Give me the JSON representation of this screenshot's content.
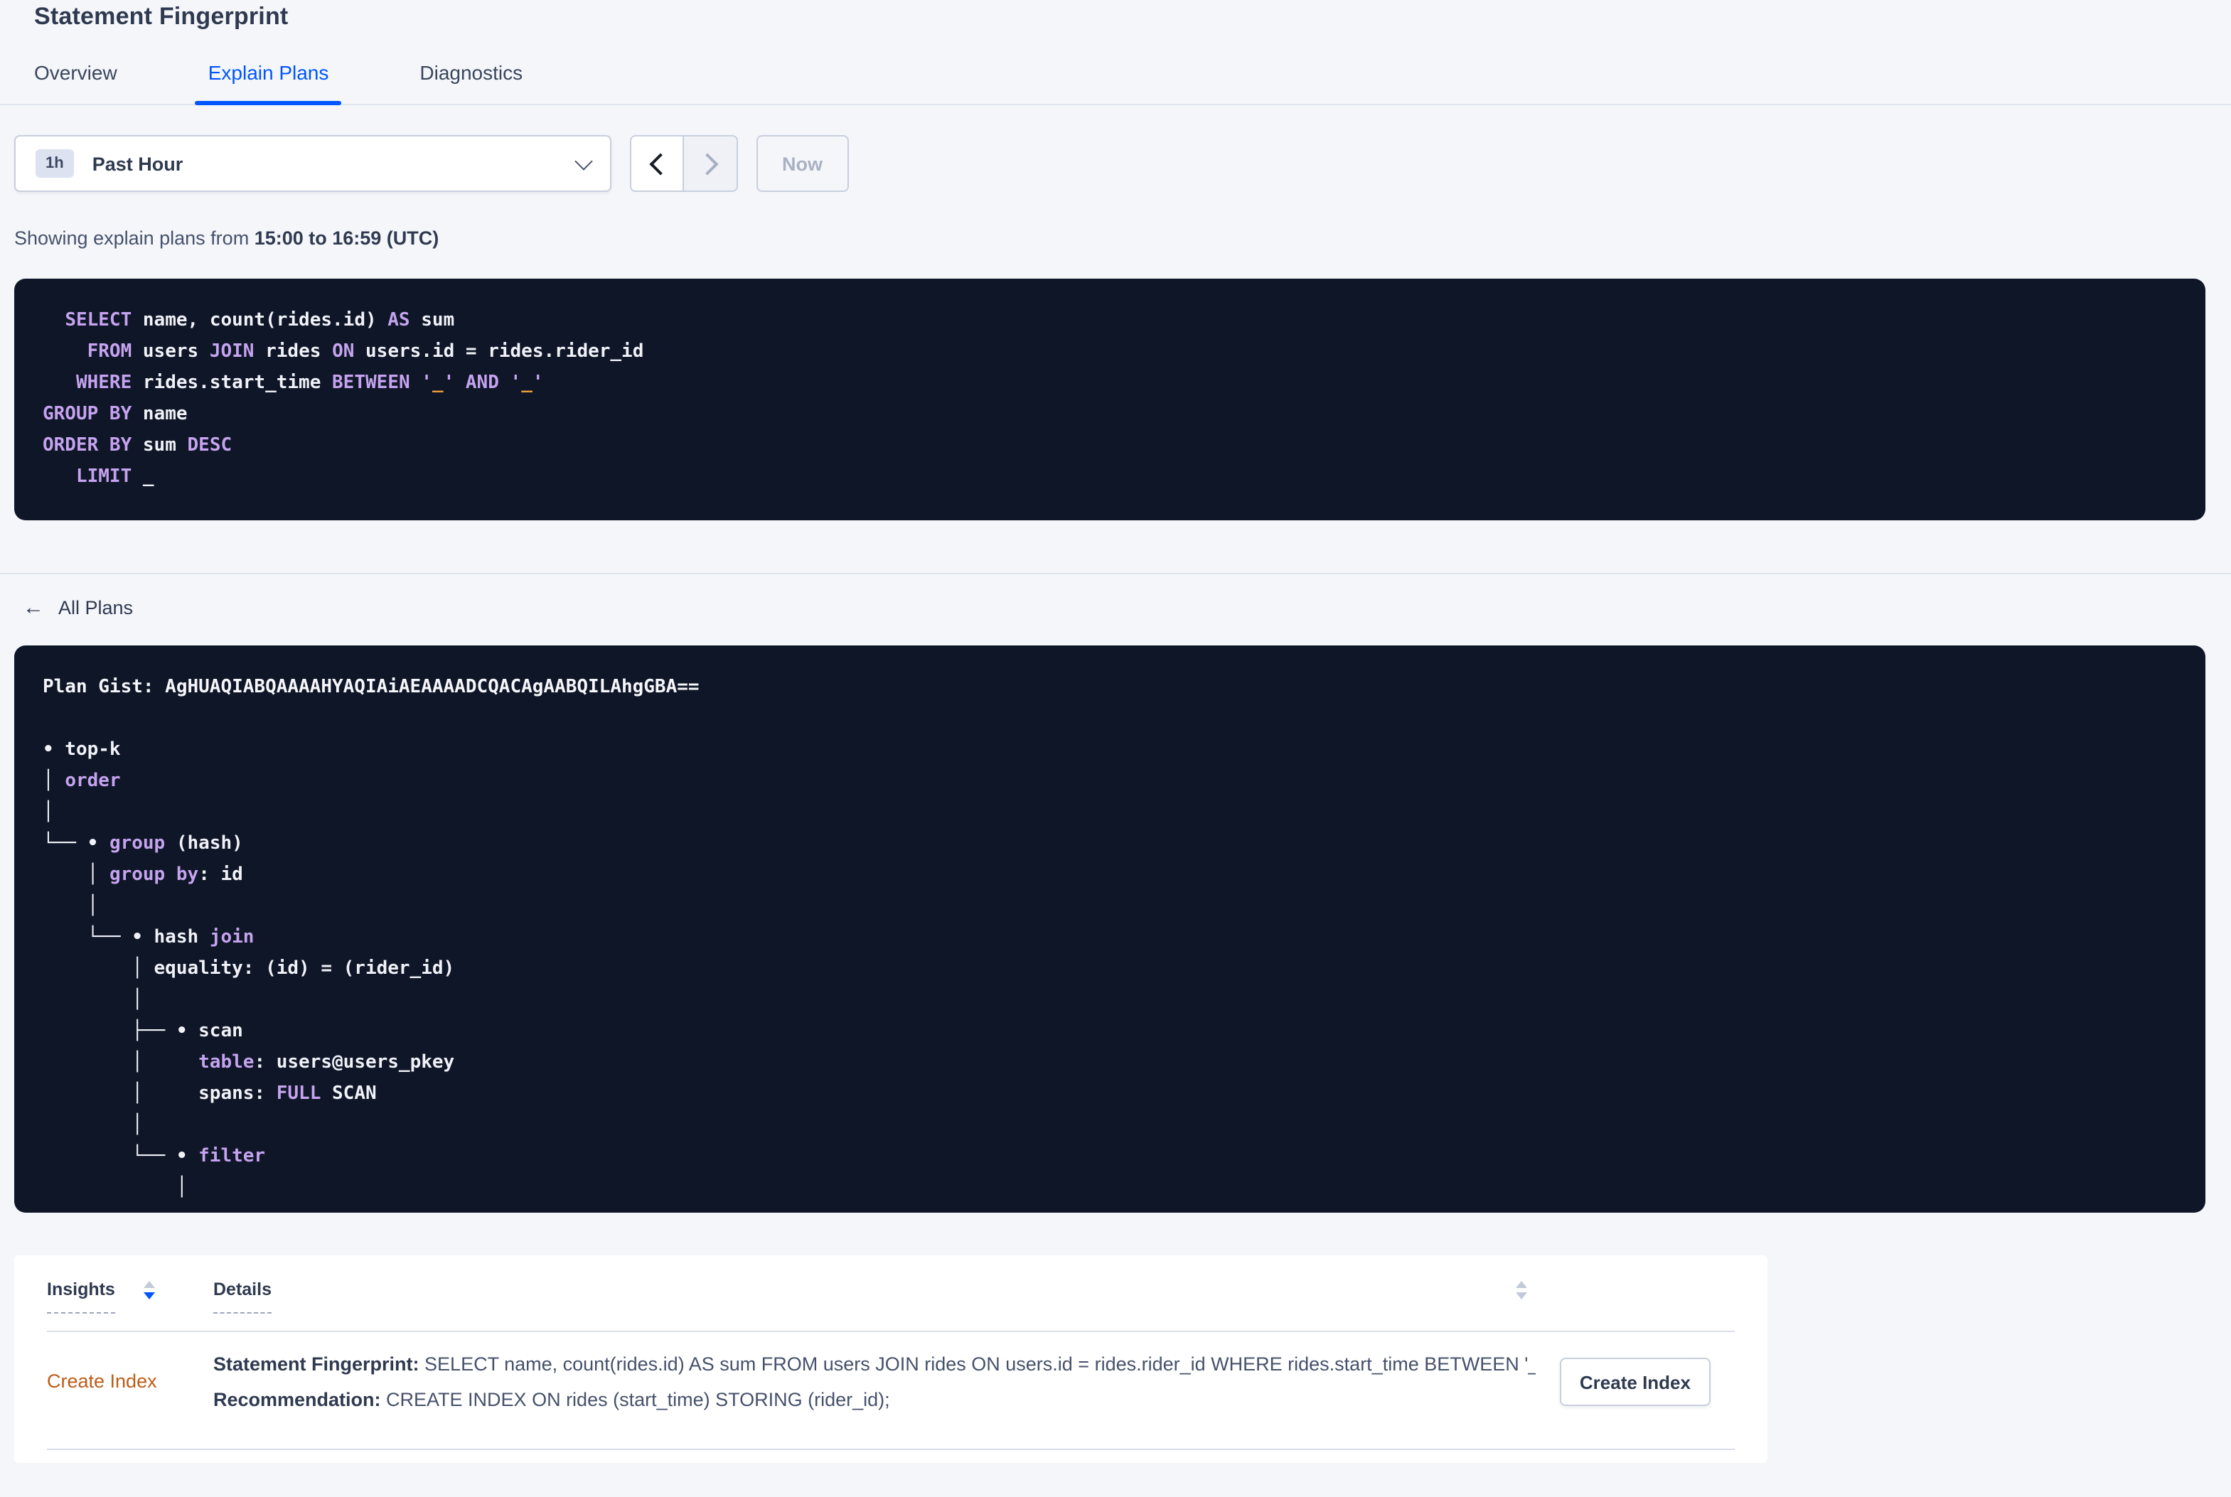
{
  "page": {
    "title": "Statement Fingerprint"
  },
  "tabs": [
    {
      "label": "Overview",
      "active": false
    },
    {
      "label": "Explain Plans",
      "active": true
    },
    {
      "label": "Diagnostics",
      "active": false
    }
  ],
  "time_picker": {
    "interval_badge": "1h",
    "label": "Past Hour",
    "now_label": "Now"
  },
  "summary": {
    "prefix": "Showing explain plans from ",
    "range_bold": "15:00 to 16:59 (UTC)"
  },
  "sql_block": {
    "lines": [
      [
        [
          "  ",
          ""
        ],
        [
          "SELECT",
          "kw"
        ],
        [
          " name, count(rides.id) ",
          ""
        ],
        [
          "AS",
          "kw"
        ],
        [
          " sum",
          ""
        ]
      ],
      [
        [
          "    ",
          ""
        ],
        [
          "FROM",
          "kw"
        ],
        [
          " users ",
          ""
        ],
        [
          "JOIN",
          "kw"
        ],
        [
          " rides ",
          ""
        ],
        [
          "ON",
          "kw"
        ],
        [
          " users.id = rides.rider_id",
          ""
        ]
      ],
      [
        [
          "   ",
          ""
        ],
        [
          "WHERE",
          "kw"
        ],
        [
          " rides.start_time ",
          ""
        ],
        [
          "BETWEEN",
          "kw"
        ],
        [
          " ",
          ""
        ],
        [
          "'",
          "kw"
        ],
        [
          "_",
          "str"
        ],
        [
          "'",
          "kw"
        ],
        [
          " ",
          ""
        ],
        [
          "AND",
          "kw"
        ],
        [
          " ",
          ""
        ],
        [
          "'",
          "kw"
        ],
        [
          "_",
          "str"
        ],
        [
          "'",
          "kw"
        ]
      ],
      [
        [
          "GROUP BY",
          "kw"
        ],
        [
          " name",
          ""
        ]
      ],
      [
        [
          "ORDER BY",
          "kw"
        ],
        [
          " sum ",
          ""
        ],
        [
          "DESC",
          "kw"
        ]
      ],
      [
        [
          "   ",
          ""
        ],
        [
          "LIMIT",
          "kw"
        ],
        [
          " _",
          ""
        ]
      ]
    ]
  },
  "back_link": {
    "label": "All Plans"
  },
  "plan_block": {
    "lines": [
      [
        [
          "Plan Gist: AgHUAQIABQAAAAHYAQIAiAEAAAADCQACAgAABQILAhgGBA==",
          "gist"
        ]
      ],
      [],
      [
        [
          "• top-k",
          ""
        ]
      ],
      [
        [
          "│ ",
          ""
        ],
        [
          "order",
          "kw"
        ]
      ],
      [
        [
          "│",
          ""
        ]
      ],
      [
        [
          "└── • ",
          ""
        ],
        [
          "group",
          "kw"
        ],
        [
          " (hash)",
          ""
        ]
      ],
      [
        [
          "    │ ",
          ""
        ],
        [
          "group by",
          "kw"
        ],
        [
          ": id",
          ""
        ]
      ],
      [
        [
          "    │",
          ""
        ]
      ],
      [
        [
          "    └── • hash ",
          ""
        ],
        [
          "join",
          "kw"
        ]
      ],
      [
        [
          "        │ equality: (id) = (rider_id)",
          ""
        ]
      ],
      [
        [
          "        │",
          ""
        ]
      ],
      [
        [
          "        ├── • scan",
          ""
        ]
      ],
      [
        [
          "        │     ",
          ""
        ],
        [
          "table",
          "kw"
        ],
        [
          ": users@users_pkey",
          ""
        ]
      ],
      [
        [
          "        │     spans: ",
          ""
        ],
        [
          "FULL",
          "kw"
        ],
        [
          " SCAN",
          ""
        ]
      ],
      [
        [
          "        │",
          ""
        ]
      ],
      [
        [
          "        └── • ",
          ""
        ],
        [
          "filter",
          "kw"
        ]
      ],
      [
        [
          "            │",
          ""
        ]
      ]
    ]
  },
  "insights_table": {
    "columns": [
      {
        "label": "Insights",
        "sort": "desc"
      },
      {
        "label": "Details",
        "sort": "none"
      }
    ],
    "rows": [
      {
        "insight_label": "Create Index",
        "details": [
          {
            "label": "Statement Fingerprint:",
            "text": "SELECT name, count(rides.id) AS sum FROM users JOIN rides ON users.id = rides.rider_id WHERE rides.start_time BETWEEN '_…"
          },
          {
            "label": "Recommendation:",
            "text": "CREATE INDEX ON rides (start_time) STORING (rider_id);"
          }
        ],
        "action_label": "Create Index"
      }
    ]
  },
  "icons": {
    "back_arrow": "←"
  },
  "colors": {
    "page_bg": "#F4F6FA",
    "card_bg": "#FFFFFF",
    "code_bg": "#0E1627",
    "code_text": "#F1F1F8",
    "keyword_purple": "#C5A3EF",
    "literal_orange": "#EFA13C",
    "accent_blue": "#0055FF",
    "link_orange": "#BC5C17",
    "text_dark": "#2F3A50",
    "text_body": "#45516B",
    "border": "#C8CFDD",
    "divider": "#E0E5ED",
    "disabled_text": "#A9B2C3",
    "sort_inactive": "#C2C9D9",
    "badge_bg": "#DDE2F0",
    "arrow_disabled_bg": "#EFF1F6"
  }
}
